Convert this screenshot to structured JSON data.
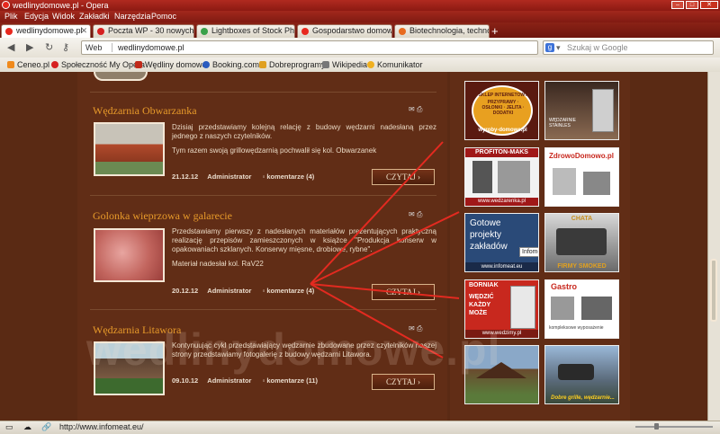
{
  "window": {
    "title": "wedlinydomowe.pl - Opera"
  },
  "menu": [
    "Plik",
    "Edycja",
    "Widok",
    "Zakładki",
    "Narzędzia",
    "Pomoc"
  ],
  "tabs": [
    {
      "label": "wedlinydomowe.pl",
      "active": true,
      "color": "#e8281e"
    },
    {
      "label": "Poczta WP - 30 nowych",
      "active": false,
      "color": "#d62020"
    },
    {
      "label": "Lightboxes of Stock Ph...",
      "active": false,
      "color": "#3aa14a"
    },
    {
      "label": "Gospodarstwo domow...",
      "active": false,
      "color": "#e8281e"
    },
    {
      "label": "Biotechnologia, techno...",
      "active": false,
      "color": "#e86a1e"
    }
  ],
  "address": {
    "scheme_label": "Web",
    "url": "wedlinydomowe.pl"
  },
  "search": {
    "placeholder": "Szukaj w Google",
    "engine_letter": "g"
  },
  "bookmarks": [
    {
      "label": "Ceneo.pl",
      "color": "#f08a1c"
    },
    {
      "label": "Społeczność My Opera",
      "color": "#d62020"
    },
    {
      "label": "Wędliny domowe",
      "color": "#c02a1a"
    },
    {
      "label": "Booking.com",
      "color": "#2a5bbf"
    },
    {
      "label": "Dobreprogramy",
      "color": "#e0a020"
    },
    {
      "label": "Wikipedia",
      "color": "#777777"
    },
    {
      "label": "Komunikator",
      "color": "#f0b020"
    }
  ],
  "articles": [
    {
      "title": "Wędzarnia Obwarzanka",
      "paragraphs": [
        "Dzisiaj przedstawiamy kolejną relację z budowy wędzarni nadesłaną przez jednego z naszych czytelników.",
        "Tym razem swoją grillowędzarnią pochwalił się kol. Obwarzanek"
      ],
      "date": "21.12.12",
      "author": "Administrator",
      "comments": "komentarze (4)",
      "read_label": "CZYTAJ ›"
    },
    {
      "title": "Golonka wieprzowa w galarecie",
      "paragraphs": [
        "Przedstawiamy pierwszy z nadesłanych materiałów prezentujących praktyczną realizację przepisów zamieszczonych w książce \"Produkcja konserw w opakowaniach szklanych. Konserwy mięsne, drobiowe, rybne\".",
        "Materiał nadesłał kol. RaV22"
      ],
      "date": "20.12.12",
      "author": "Administrator",
      "comments": "komentarze (4)",
      "read_label": "CZYTAJ ›"
    },
    {
      "title": "Wędzarnia Litawora",
      "paragraphs": [
        "Kontynuując cykl przedstawiający wędzarnie zbudowane przez czytelników naszej strony przedstawiamy fotogalerię z budowy wędzarni Litawora."
      ],
      "date": "09.10.12",
      "author": "Administrator",
      "comments": "komentarze (11)",
      "read_label": "CZYTAJ ›"
    }
  ],
  "ads": {
    "a1_top": "SKLEP INTERNETOWY",
    "a1_items": "PRZYPRAWY · OSŁONKI · JELITA · DODATKI",
    "a1_url": "wyroby-domowe.pl",
    "a2": "WĘDZARNIE STAINLES",
    "a3_title": "PROFITON-MAKS",
    "a3_url": "www.wedzarenka.pl",
    "a4_title": "ZdrowoDomowo.pl",
    "a5_text": "Gotowe projekty zakładów",
    "a5_tag": "Infomeat",
    "a5_url": "www.infomeat.eu",
    "a6_title": "CHATA",
    "a6_sub": "FIRMY SMOKED",
    "a7_brand": "BORNIAK",
    "a7_text": "WĘDZIĆ KAŻDY MOŻE",
    "a7_url": "www.wedzimy.pl",
    "a8_title": "Gastro",
    "a8_sub": "kompleksowe wyposażenie",
    "a10_text": "Dobre grille, wędzarnie..."
  },
  "watermark": "wedlinydomowe.pl",
  "status": {
    "url": "http://www.infomeat.eu/"
  }
}
